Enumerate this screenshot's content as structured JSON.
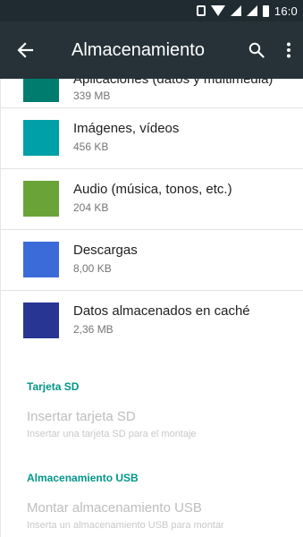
{
  "statusbar": {
    "time": "16:0",
    "icons": [
      "vibrate-icon",
      "wifi-icon",
      "signal-icon",
      "signal-icon",
      "battery-icon"
    ]
  },
  "appbar": {
    "title": "Almacenamiento",
    "icons": [
      "back-arrow-icon",
      "search-icon",
      "overflow-menu-icon"
    ]
  },
  "categories": [
    {
      "name": "Aplicaciones (datos y multimedia)",
      "size": "339 MB",
      "color": "#007c6e"
    },
    {
      "name": "Imágenes, vídeos",
      "size": "456 KB",
      "color": "#00a0a8"
    },
    {
      "name": "Audio (música, tonos, etc.)",
      "size": "204 KB",
      "color": "#6aa438"
    },
    {
      "name": "Descargas",
      "size": "8,00 KB",
      "color": "#3a6bd8"
    },
    {
      "name": "Datos almacenados en caché",
      "size": "2,36 MB",
      "color": "#283593"
    }
  ],
  "sd": {
    "header": "Tarjeta SD",
    "title": "Insertar tarjeta SD",
    "subtitle": "Insertar una tarjeta SD para el montaje"
  },
  "usb": {
    "header": "Almacenamiento USB",
    "title": "Montar almacenamiento USB",
    "subtitle": "Inserta un almacenamiento USB para montar"
  },
  "colors": {
    "statusbar": "#1f2b30",
    "appbar": "#263238",
    "accent": "#009688",
    "disabled_text": "#bdbdbd"
  }
}
